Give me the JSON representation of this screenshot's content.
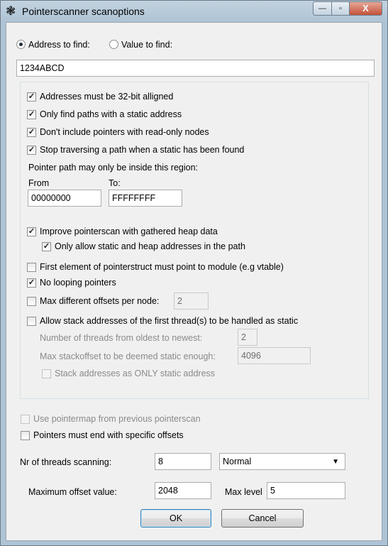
{
  "window": {
    "title": "Pointerscanner scanoptions",
    "controls": {
      "minimize": "—",
      "maximize": "▫",
      "close": "X"
    }
  },
  "find_mode": {
    "address_label": "Address to find:",
    "value_label": "Value to find:",
    "selected": "address",
    "address_value": "1234ABCD"
  },
  "options": {
    "aligned": {
      "label": "Addresses must be 32-bit alligned",
      "checked": true
    },
    "static_only": {
      "label": "Only find paths with a static address",
      "checked": true
    },
    "no_readonly": {
      "label": "Don't include pointers with read-only nodes",
      "checked": true
    },
    "stop_traversing": {
      "label": "Stop traversing a path when a static has been found",
      "checked": true
    },
    "region_label": "Pointer path may only be inside this region:",
    "from_label": "From",
    "to_label": "To:",
    "from_value": "00000000",
    "to_value": "FFFFFFFF",
    "heap_data": {
      "label": "Improve pointerscan with gathered heap data",
      "checked": true
    },
    "static_heap_only": {
      "label": "Only allow static and heap addresses in the path",
      "checked": true
    },
    "first_element": {
      "label": "First element of pointerstruct must point to module (e.g vtable)",
      "checked": false
    },
    "no_looping": {
      "label": "No looping pointers",
      "checked": true
    },
    "max_offsets": {
      "label": "Max different offsets per node:",
      "checked": false,
      "value": "2"
    },
    "stack_static": {
      "label": "Allow stack addresses of the first thread(s) to be handled as static",
      "checked": false
    },
    "threads_oldest_label": "Number of threads from oldest to newest:",
    "threads_oldest_value": "2",
    "max_stackoffset_label": "Max stackoffset to be deemed static enough:",
    "max_stackoffset_value": "4096",
    "stack_only_static": {
      "label": "Stack addresses as ONLY static address",
      "checked": false
    }
  },
  "bottom": {
    "use_pointermap": {
      "label": "Use pointermap from previous pointerscan",
      "checked": false
    },
    "end_offsets": {
      "label": "Pointers must end with specific offsets",
      "checked": false
    },
    "threads_label": "Nr of threads scanning:",
    "threads_value": "8",
    "priority_value": "Normal",
    "max_offset_label": "Maximum offset value:",
    "max_offset_value": "2048",
    "max_level_label": "Max level",
    "max_level_value": "5",
    "ok_label": "OK",
    "cancel_label": "Cancel"
  }
}
